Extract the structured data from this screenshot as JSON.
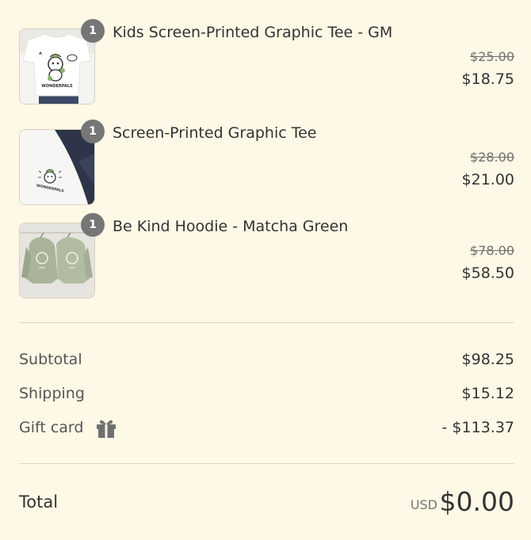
{
  "items": [
    {
      "name": "Kids Screen-Printed Graphic Tee - GM",
      "quantity": "1",
      "original_price": "$25.00",
      "price": "$18.75",
      "icon": "kids-tee-thumbnail",
      "print_text": "WONDERPALS"
    },
    {
      "name": "Screen-Printed Graphic Tee",
      "quantity": "1",
      "original_price": "$28.00",
      "price": "$21.00",
      "icon": "graphic-tee-thumbnail",
      "print_text": "WONDERPALS"
    },
    {
      "name": "Be Kind Hoodie - Matcha Green",
      "quantity": "1",
      "original_price": "$78.00",
      "price": "$58.50",
      "icon": "hoodie-thumbnail"
    }
  ],
  "summary": {
    "subtotal_label": "Subtotal",
    "subtotal_value": "$98.25",
    "shipping_label": "Shipping",
    "shipping_value": "$15.12",
    "gift_card_label": "Gift card",
    "gift_card_value": "- $113.37",
    "gift_card_icon": "gift-icon"
  },
  "total": {
    "label": "Total",
    "currency": "USD",
    "value": "$0.00"
  },
  "colors": {
    "background": "#fef8e6",
    "badge": "#767676",
    "text": "#333333",
    "muted": "#707070",
    "divider": "#dcd6c5"
  }
}
